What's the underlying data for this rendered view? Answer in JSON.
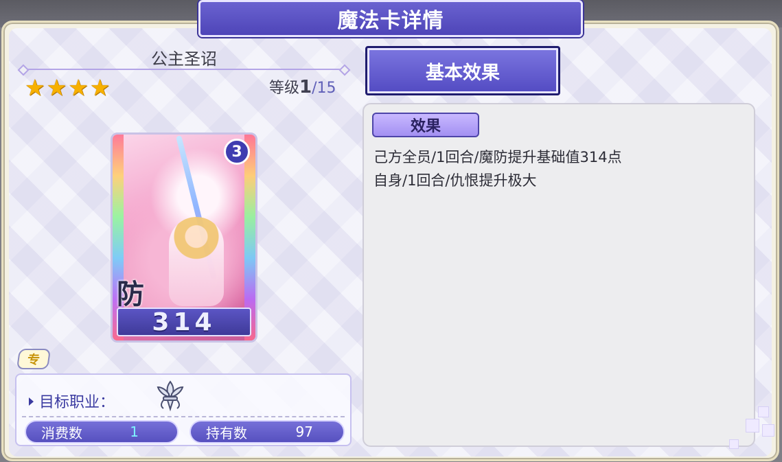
{
  "window": {
    "title": "魔法卡详情"
  },
  "card": {
    "name": "公主圣诏",
    "star_count": 4,
    "level_label": "等级",
    "level_current": "1",
    "level_separator": "/",
    "level_max": "15",
    "tier_badge": "3",
    "type_char": "防",
    "value": "314",
    "exclusive_tag": "专"
  },
  "info": {
    "target_label": "目标职业：",
    "target_icon": "fleur-de-lis-icon",
    "cost_label": "消费数",
    "cost_value": "1",
    "owned_label": "持有数",
    "owned_value": "97"
  },
  "effects": {
    "tab_label": "基本效果",
    "section_label": "效果",
    "lines": [
      "己方全员/1回合/魔防提升基础值314点",
      "自身/1回合/仇恨提升极大"
    ]
  },
  "colors": {
    "accent": "#524ac2",
    "star": "#f7b000",
    "highlight_value": "#7ef3ff"
  }
}
